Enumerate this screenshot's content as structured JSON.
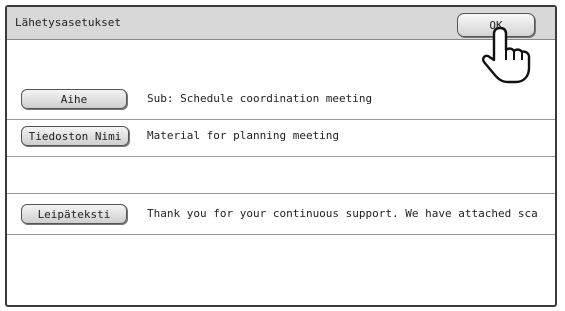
{
  "dialog": {
    "title": "Lähetysasetukset",
    "ok_label": "OK"
  },
  "rows": [
    {
      "button_label": "Aihe",
      "value": "Sub: Schedule coordination meeting"
    },
    {
      "button_label": "Tiedoston Nimi",
      "value": "Material for planning meeting"
    },
    {
      "button_label": "Leipäteksti",
      "value": "Thank you for your continuous support. We have attached sca"
    }
  ],
  "icons": {
    "pointer": "pointing-hand-icon"
  }
}
